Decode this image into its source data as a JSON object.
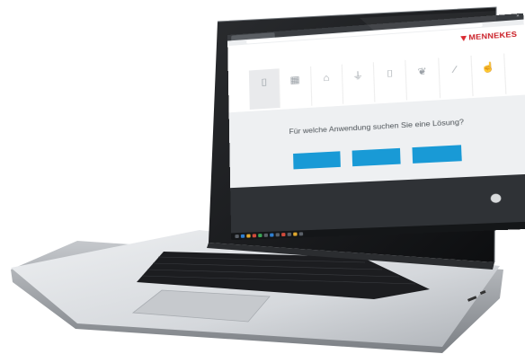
{
  "browser": {
    "tab_title": "",
    "address": ""
  },
  "site": {
    "brand_name": "MENNEKES",
    "nav": [
      "",
      "",
      "",
      "",
      "",
      ""
    ],
    "header_note": "",
    "categories": [
      {
        "label": "",
        "icon": "charger-icon",
        "active": true
      },
      {
        "label": "",
        "icon": "grid-icon",
        "active": false
      },
      {
        "label": "",
        "icon": "building-icon",
        "active": false
      },
      {
        "label": "",
        "icon": "plug-icon",
        "active": false
      },
      {
        "label": "",
        "icon": "bracket-icon",
        "active": false
      },
      {
        "label": "",
        "icon": "leaf-icon",
        "active": false
      },
      {
        "label": "",
        "icon": "wand-icon",
        "active": false
      },
      {
        "label": "",
        "icon": "thumbs-up-icon",
        "active": false
      }
    ],
    "question": "Für welche Anwendung suchen Sie eine Lösung?",
    "question_sub": "",
    "cta_buttons": [
      "",
      "",
      ""
    ],
    "footer": {
      "links_row1": [
        "",
        "",
        ""
      ],
      "links_row2": [
        "",
        ""
      ],
      "middle_text": "",
      "right_text": "",
      "badge_label": ""
    }
  },
  "taskbar": {
    "time": ""
  },
  "colors": {
    "brand_red": "#d81f26",
    "cta_blue": "#199ad6",
    "footer_bg": "#2f3236",
    "laptop_silver": "#d3d6da"
  }
}
